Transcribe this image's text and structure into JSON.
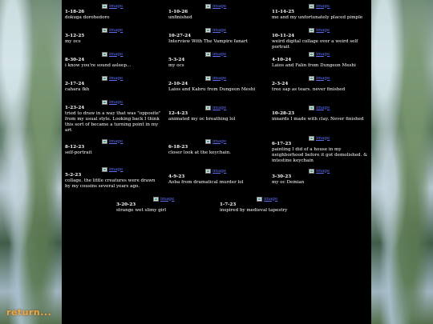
{
  "image_alt": "image",
  "return_link": "return...",
  "entries": [
    {
      "date": "1-18-26",
      "desc": "dokuga dorohedoro"
    },
    {
      "date": "1-10-26",
      "desc": "unfinished"
    },
    {
      "date": "11-14-25",
      "desc": "me and my unfortunately placed pimple"
    },
    {
      "date": "3-12-25",
      "desc": "my ocs"
    },
    {
      "date": "10-27-24",
      "desc": "Interview With The Vampire fanart"
    },
    {
      "date": "10-11-24",
      "desc": "weird digital collage over a weird self portrait"
    },
    {
      "date": "8-30-24",
      "desc": "i know you're sound asleep..."
    },
    {
      "date": "5-3-24",
      "desc": "my ocs"
    },
    {
      "date": "4-10-24",
      "desc": "Laios and Falin from Dungeon Meshi"
    },
    {
      "date": "2-17-24",
      "desc": "cahara fkh"
    },
    {
      "date": "2-10-24",
      "desc": "Laios and Kabru from Dungeon Meshi"
    },
    {
      "date": "2-3-24",
      "desc": "tree sap as tears. never finished"
    },
    {
      "date": "1-23-24",
      "desc": "tried to draw in a way that was \"opposite\" from my usual style. Looking back I think this sort of became a turning point in my art"
    },
    {
      "date": "12-4-23",
      "desc": "animated my oc breathing lol"
    },
    {
      "date": "10-28-23",
      "desc": "innards I made with clay. Never finished"
    },
    {
      "date": "8-12-23",
      "desc": "self-portrait"
    },
    {
      "date": "6-18-23",
      "desc": "closer look at the keychain."
    },
    {
      "date": "6-17-23",
      "desc": "painting I did of a house in my neighborhood before it got demolished. & intestine keychain"
    },
    {
      "date": "5-2-23",
      "desc": "collage. the little creatures were drawn by my cousins several years ago."
    },
    {
      "date": "4-9-23",
      "desc": "Aoba from dramatical murder lol"
    },
    {
      "date": "3-30-23",
      "desc": "my oc Demian"
    },
    {
      "date": "3-20-23",
      "desc": "strange wet slimy girl"
    },
    {
      "date": "1-7-23",
      "desc": "inspired by medieval tapestry"
    }
  ]
}
